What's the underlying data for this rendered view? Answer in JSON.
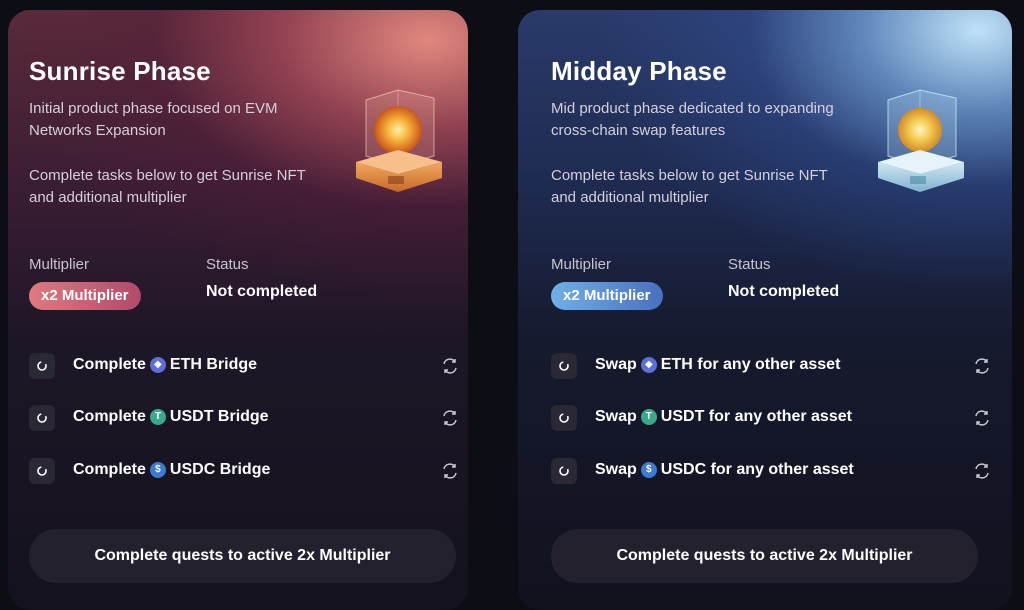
{
  "cards": [
    {
      "title": "Sunrise Phase",
      "description": "Initial product phase focused on EVM Networks Expansion",
      "instruction": "Complete tasks below to get Sunrise NFT and additional multiplier",
      "multiplier_label": "Multiplier",
      "multiplier_badge": "x2 Multiplier",
      "status_label": "Status",
      "status_value": "Not completed",
      "tasks": [
        {
          "prefix": "Complete",
          "coin": "ETH",
          "suffix": "ETH Bridge"
        },
        {
          "prefix": "Complete",
          "coin": "USDT",
          "suffix": "USDT Bridge"
        },
        {
          "prefix": "Complete",
          "coin": "USDC",
          "suffix": "USDC Bridge"
        }
      ],
      "cta": "Complete quests to active 2x Multiplier"
    },
    {
      "title": "Midday Phase",
      "description": "Mid product phase dedicated to expanding cross-chain swap features",
      "instruction": "Complete tasks below to get Sunrise NFT and additional multiplier",
      "multiplier_label": "Multiplier",
      "multiplier_badge": "x2 Multiplier",
      "status_label": "Status",
      "status_value": "Not completed",
      "tasks": [
        {
          "prefix": "Swap",
          "coin": "ETH",
          "suffix": "ETH for any other asset"
        },
        {
          "prefix": "Swap",
          "coin": "USDT",
          "suffix": "USDT for any other asset"
        },
        {
          "prefix": "Swap",
          "coin": "USDC",
          "suffix": "USDC for any other asset"
        }
      ],
      "cta": "Complete quests to active 2x Multiplier"
    }
  ],
  "icons": {
    "task_status": "loading-circle-icon",
    "refresh": "refresh-icon",
    "coins": {
      "ETH": "ethereum-icon",
      "USDT": "tether-icon",
      "USDC": "usdc-icon"
    },
    "nft": "sun-cube-nft-icon"
  },
  "colors": {
    "sunrise_accent": "#e07a7e",
    "midday_accent": "#6fb0e8",
    "card_bg": "#14121e"
  }
}
